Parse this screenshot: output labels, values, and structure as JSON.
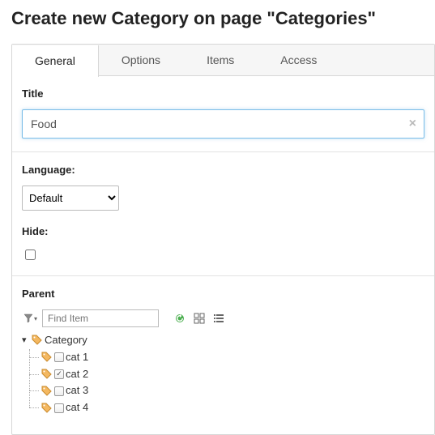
{
  "pageTitle": "Create new Category on page \"Categories\"",
  "tabs": [
    {
      "label": "General",
      "active": true
    },
    {
      "label": "Options",
      "active": false
    },
    {
      "label": "Items",
      "active": false
    },
    {
      "label": "Access",
      "active": false
    }
  ],
  "titleField": {
    "label": "Title",
    "value": "Food"
  },
  "languageField": {
    "label": "Language:",
    "options": [
      "Default"
    ],
    "selected": "Default"
  },
  "hideField": {
    "label": "Hide:",
    "checked": false
  },
  "parentField": {
    "label": "Parent",
    "findPlaceholder": "Find Item",
    "root": {
      "label": "Category",
      "expanded": true
    },
    "items": [
      {
        "label": "cat 1",
        "checked": false
      },
      {
        "label": "cat 2",
        "checked": true
      },
      {
        "label": "cat 3",
        "checked": false
      },
      {
        "label": "cat 4",
        "checked": false
      }
    ]
  }
}
